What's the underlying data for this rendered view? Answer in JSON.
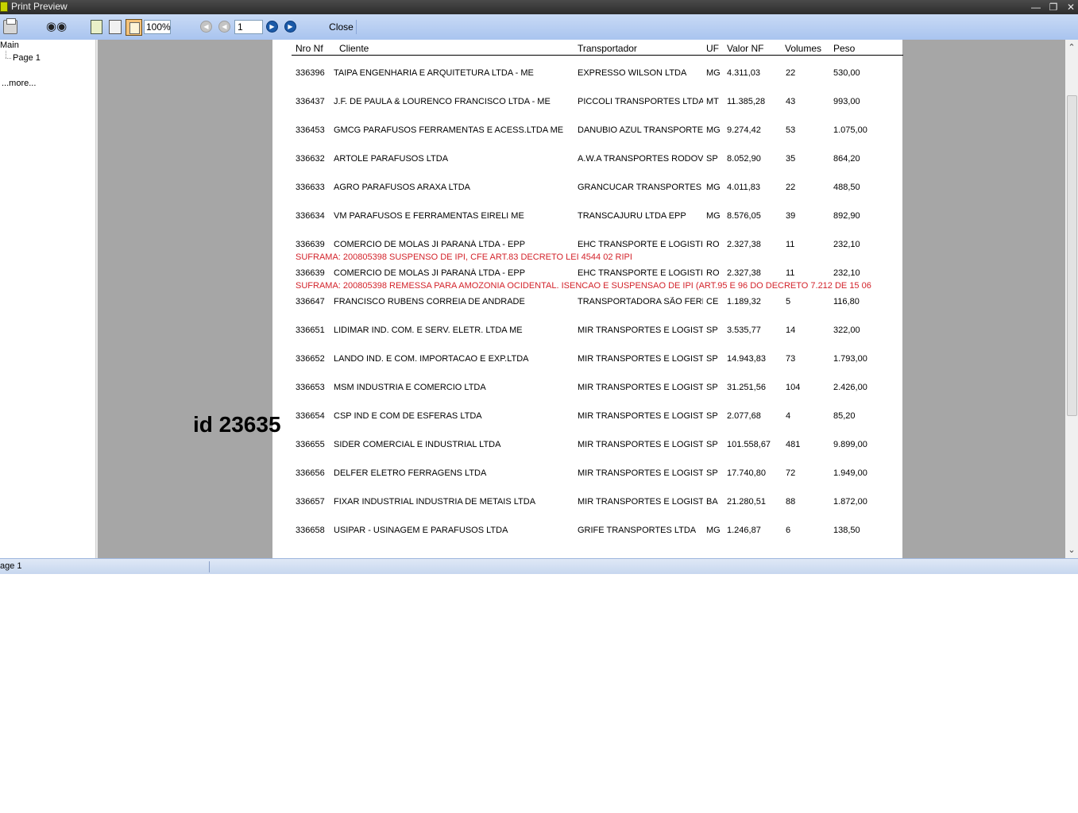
{
  "window": {
    "title": "Print Preview"
  },
  "toolbar": {
    "zoom": "100%",
    "page": "1",
    "close_label": "Close"
  },
  "tree": {
    "root": "Main",
    "child": "Page 1",
    "more": "...more..."
  },
  "report": {
    "headers": [
      "Nro Nf",
      "Cliente",
      "Transportador",
      "UF",
      "Valor NF",
      "Volumes",
      "Peso"
    ],
    "rows": [
      {
        "nf": "336396",
        "cliente": "TAIPA ENGENHARIA E ARQUITETURA LTDA - ME",
        "transp": "EXPRESSO WILSON LTDA",
        "uf": "MG",
        "valor": "4.311,03",
        "vol": "22",
        "peso": "530,00"
      },
      {
        "nf": "336437",
        "cliente": "J.F. DE PAULA & LOURENCO FRANCISCO LTDA - ME",
        "transp": "PICCOLI TRANSPORTES LTDA",
        "uf": "MT",
        "valor": "11.385,28",
        "vol": "43",
        "peso": "993,00"
      },
      {
        "nf": "336453",
        "cliente": "GMCG PARAFUSOS FERRAMENTAS E ACESS.LTDA ME",
        "transp": "DANUBIO AZUL TRANSPORTES",
        "uf": "MG",
        "valor": "9.274,42",
        "vol": "53",
        "peso": "1.075,00"
      },
      {
        "nf": "336632",
        "cliente": "ARTOLE PARAFUSOS LTDA",
        "transp": "A.W.A TRANSPORTES RODOVIA",
        "uf": "SP",
        "valor": "8.052,90",
        "vol": "35",
        "peso": "864,20"
      },
      {
        "nf": "336633",
        "cliente": "AGRO PARAFUSOS ARAXA LTDA",
        "transp": "GRANCUCAR TRANSPORTES LT",
        "uf": "MG",
        "valor": "4.011,83",
        "vol": "22",
        "peso": "488,50"
      },
      {
        "nf": "336634",
        "cliente": "VM PARAFUSOS E FERRAMENTAS EIRELI ME",
        "transp": "TRANSCAJURU LTDA EPP",
        "uf": "MG",
        "valor": "8.576,05",
        "vol": "39",
        "peso": "892,90"
      },
      {
        "nf": "336639",
        "cliente": "COMERCIO DE MOLAS JI PARANÁ LTDA - EPP",
        "transp": "EHC TRANSPORTE E LOGISTICA",
        "uf": "RO",
        "valor": "2.327,38",
        "vol": "11",
        "peso": "232,10"
      },
      {
        "nf": "336639",
        "cliente": "COMERCIO DE MOLAS JI PARANÁ LTDA - EPP",
        "transp": "EHC TRANSPORTE E LOGISTICA",
        "uf": "RO",
        "valor": "2.327,38",
        "vol": "11",
        "peso": "232,10"
      },
      {
        "nf": "336647",
        "cliente": "FRANCISCO RUBENS CORREIA DE ANDRADE",
        "transp": "TRANSPORTADORA SÃO FERN/",
        "uf": "CE",
        "valor": "1.189,32",
        "vol": "5",
        "peso": "116,80"
      },
      {
        "nf": "336651",
        "cliente": "LIDIMAR IND. COM. E SERV. ELETR. LTDA ME",
        "transp": "MIR TRANSPORTES E LOGISTICA",
        "uf": "SP",
        "valor": "3.535,77",
        "vol": "14",
        "peso": "322,00"
      },
      {
        "nf": "336652",
        "cliente": "LANDO IND. E COM. IMPORTACAO E EXP.LTDA",
        "transp": "MIR TRANSPORTES E LOGISTICA",
        "uf": "SP",
        "valor": "14.943,83",
        "vol": "73",
        "peso": "1.793,00"
      },
      {
        "nf": "336653",
        "cliente": "MSM INDUSTRIA E COMERCIO LTDA",
        "transp": "MIR TRANSPORTES E LOGISTICA",
        "uf": "SP",
        "valor": "31.251,56",
        "vol": "104",
        "peso": "2.426,00"
      },
      {
        "nf": "336654",
        "cliente": "CSP IND E COM DE ESFERAS LTDA",
        "transp": "MIR TRANSPORTES E LOGISTICA",
        "uf": "SP",
        "valor": "2.077,68",
        "vol": "4",
        "peso": "85,20"
      },
      {
        "nf": "336655",
        "cliente": "SIDER COMERCIAL E INDUSTRIAL LTDA",
        "transp": "MIR TRANSPORTES E LOGISTICA",
        "uf": "SP",
        "valor": "101.558,67",
        "vol": "481",
        "peso": "9.899,00"
      },
      {
        "nf": "336656",
        "cliente": "DELFER ELETRO FERRAGENS LTDA",
        "transp": "MIR TRANSPORTES E LOGISTICA",
        "uf": "SP",
        "valor": "17.740,80",
        "vol": "72",
        "peso": "1.949,00"
      },
      {
        "nf": "336657",
        "cliente": "FIXAR INDUSTRIAL INDUSTRIA DE METAIS LTDA",
        "transp": "MIR TRANSPORTES E LOGISTICA",
        "uf": "BA",
        "valor": "21.280,51",
        "vol": "88",
        "peso": "1.872,00"
      },
      {
        "nf": "336658",
        "cliente": "USIPAR - USINAGEM E PARAFUSOS LTDA",
        "transp": "GRIFE TRANSPORTES LTDA",
        "uf": "MG",
        "valor": "1.246,87",
        "vol": "6",
        "peso": "138,50"
      }
    ],
    "notes": [
      "SUFRAMA: 200805398    SUSPENSO DE IPI, CFE ART.83 DECRETO LEI 4544 02 RIPI",
      "SUFRAMA: 200805398  REMESSA PARA AMOZONIA OCIDENTAL. ISENCAO E SUSPENSAO DE IPI (ART.95 E 96 DO DECRETO 7.212 DE 15 06"
    ]
  },
  "statusbar": {
    "page": "age 1"
  },
  "overlay": {
    "text": "id 23635"
  }
}
